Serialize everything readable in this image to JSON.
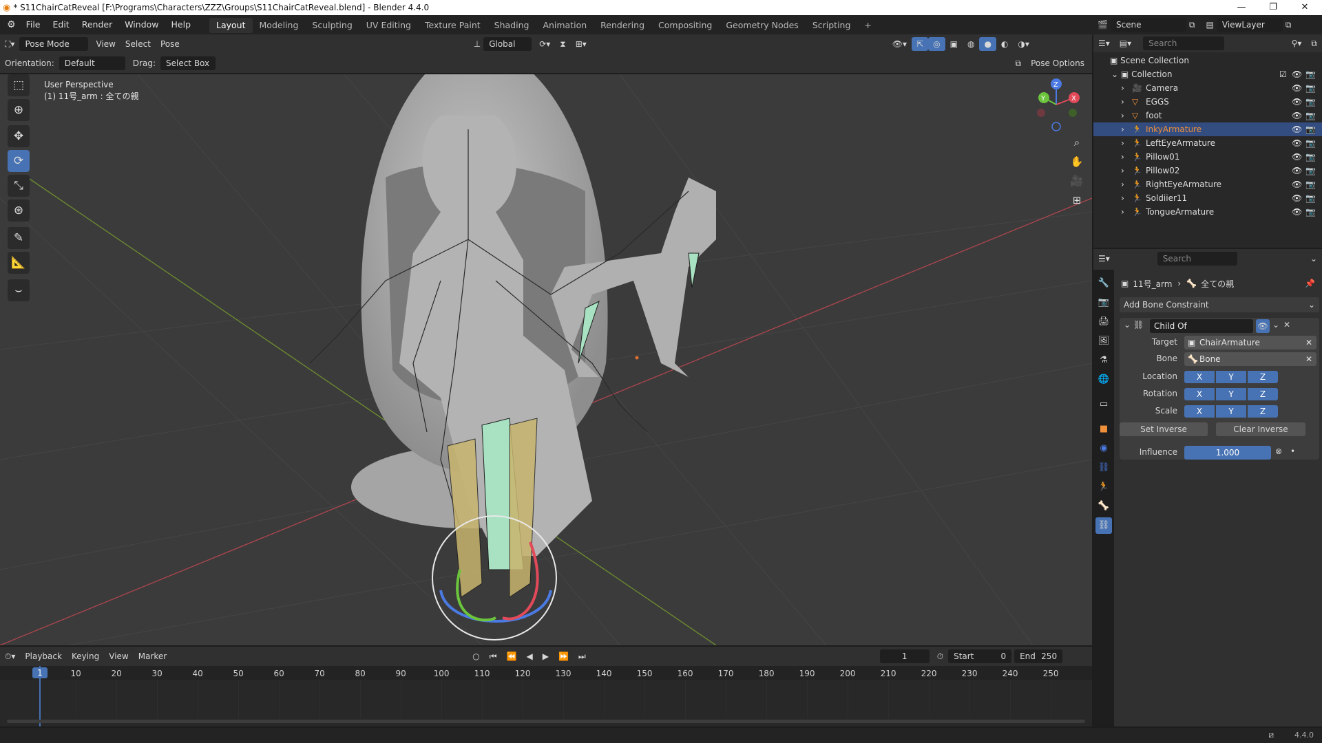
{
  "titlebar": {
    "title": "* S11ChairCatReveal [F:\\Programs\\Characters\\ZZZ\\Groups\\S11ChairCatReveal.blend] - Blender 4.4.0",
    "minimize": "—",
    "maximize": "❐",
    "close": "✕"
  },
  "menu": {
    "items": [
      "File",
      "Edit",
      "Render",
      "Window",
      "Help"
    ],
    "workspaces": [
      "Layout",
      "Modeling",
      "Sculpting",
      "UV Editing",
      "Texture Paint",
      "Shading",
      "Animation",
      "Rendering",
      "Compositing",
      "Geometry Nodes",
      "Scripting"
    ],
    "add_tab": "+",
    "scene_value": "Scene",
    "viewlayer_value": "ViewLayer"
  },
  "viewport_header": {
    "mode": "Pose Mode",
    "view": "View",
    "select": "Select",
    "pose": "Pose",
    "transform_orientation": "Global",
    "orientation_label": "Orientation:",
    "orientation_value": "Default",
    "drag_label": "Drag:",
    "drag_value": "Select Box",
    "pose_options": "Pose Options"
  },
  "viewport": {
    "perspective": "User Perspective",
    "active_info": "(1) 11号_arm : 全ての親"
  },
  "gizmo": {
    "x": "X",
    "y": "Y",
    "z": "Z"
  },
  "outliner": {
    "search_placeholder": "Search",
    "scene_collection": "Scene Collection",
    "collection": "Collection",
    "items": [
      {
        "name": "Camera",
        "type": "camera",
        "selected": false
      },
      {
        "name": "EGGS",
        "type": "mesh",
        "selected": false
      },
      {
        "name": "foot",
        "type": "mesh",
        "selected": false
      },
      {
        "name": "InkyArmature",
        "type": "armature",
        "selected": true
      },
      {
        "name": "LeftEyeArmature",
        "type": "armature",
        "selected": false
      },
      {
        "name": "Pillow01",
        "type": "armature",
        "selected": false
      },
      {
        "name": "Pillow02",
        "type": "armature",
        "selected": false
      },
      {
        "name": "RightEyeArmature",
        "type": "armature",
        "selected": false
      },
      {
        "name": "Soldiier11",
        "type": "armature",
        "selected": false
      },
      {
        "name": "TongueArmature",
        "type": "armature",
        "selected": false
      }
    ]
  },
  "properties": {
    "search_placeholder": "Search",
    "breadcrumb_object": "11号_arm",
    "breadcrumb_bone": "全ての親",
    "add_constraint": "Add Bone Constraint",
    "constraint_name": "Child Of",
    "target_label": "Target",
    "target_value": "ChairArmature",
    "bone_label": "Bone",
    "bone_value": "Bone",
    "location_label": "Location",
    "rotation_label": "Rotation",
    "scale_label": "Scale",
    "axes": [
      "X",
      "Y",
      "Z"
    ],
    "set_inverse": "Set Inverse",
    "clear_inverse": "Clear Inverse",
    "influence_label": "Influence",
    "influence_value": "1.000"
  },
  "timeline": {
    "playback": "Playback",
    "keying": "Keying",
    "view": "View",
    "marker": "Marker",
    "current_frame": "1",
    "start_label": "Start",
    "start_value": "0",
    "end_label": "End",
    "end_value": "250",
    "ticks": [
      "10",
      "20",
      "30",
      "40",
      "50",
      "60",
      "70",
      "80",
      "90",
      "100",
      "110",
      "120",
      "130",
      "140",
      "150",
      "160",
      "170",
      "180",
      "190",
      "200",
      "210",
      "220",
      "230",
      "240",
      "250"
    ],
    "playhead": "1"
  },
  "statusbar": {
    "version": "4.4.0"
  },
  "colors": {
    "accent": "#4772b3",
    "selected_text": "#f0903a",
    "bone_green": "#7fd1a3",
    "bone_yellow": "#c9b56e"
  }
}
